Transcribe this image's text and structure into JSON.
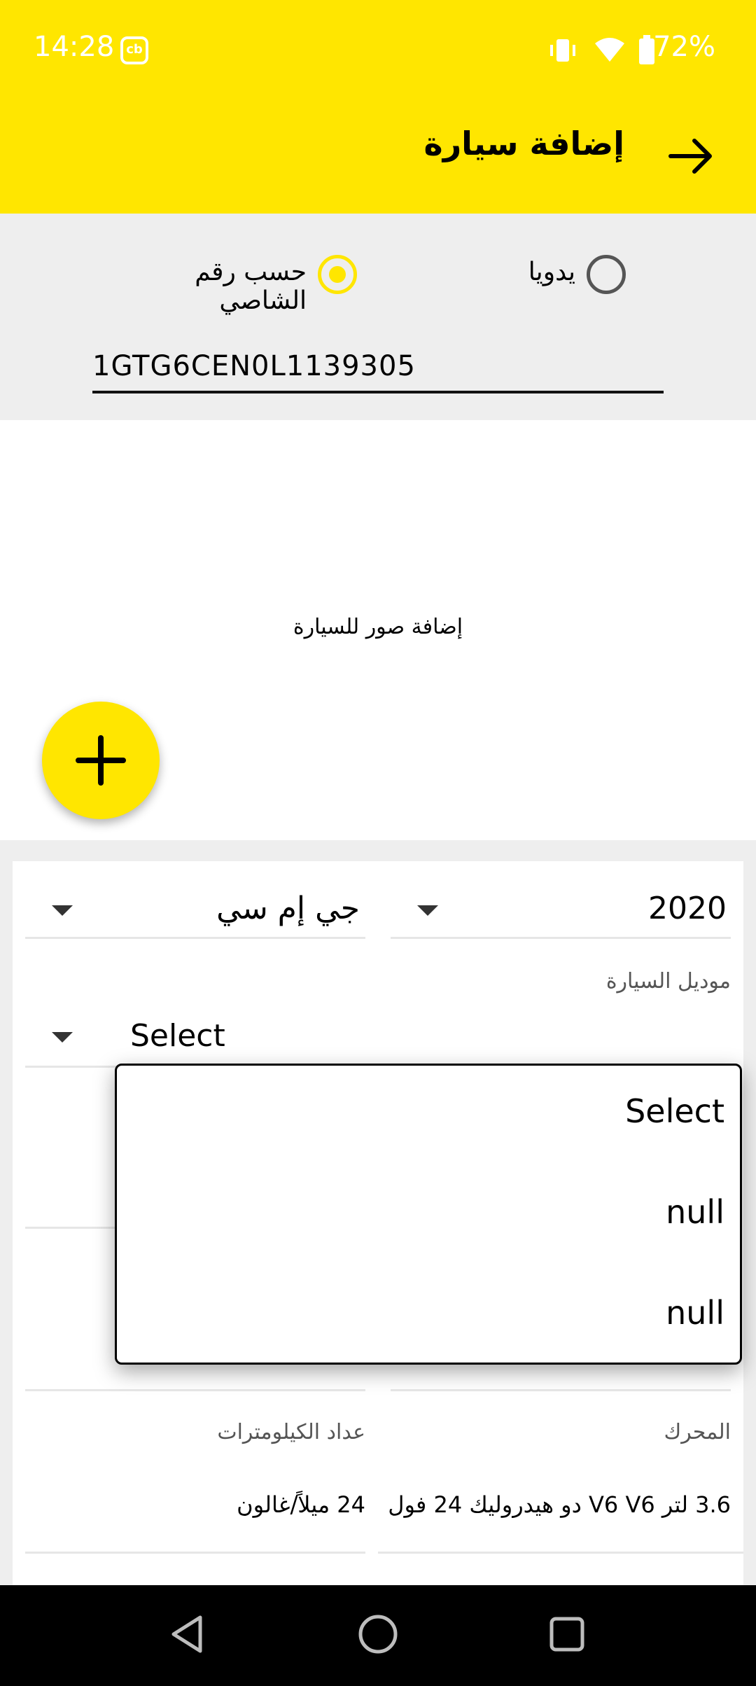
{
  "status_bar": {
    "time": "14:28",
    "battery": "72%",
    "app_badge": "cb"
  },
  "app_bar": {
    "title": "إضافة سيارة"
  },
  "mode": {
    "options": [
      {
        "label": "حسب رقم الشاصي",
        "selected": true
      },
      {
        "label": "يدويا",
        "selected": false
      }
    ],
    "vin_value": "1GTG6CEN0L1139305"
  },
  "photos": {
    "label": "إضافة صور للسيارة"
  },
  "form": {
    "make_value": "جي إم سي",
    "year_value": "2020",
    "model_label": "موديل السيارة",
    "model_value": "Select",
    "mileage_label": "عداد الكيلومترات",
    "mileage_value": "24 ميلاً/غالون",
    "engine_label": "المحرك",
    "engine_value": "3.6 لتر V6 V6 دو هيدروليك 24 فول"
  },
  "dropdown_popup": {
    "options": [
      "Select",
      "null",
      "null"
    ]
  },
  "colors": {
    "accent": "#ffe600",
    "section_bg": "#eeeeee",
    "nav_bar": "#000000"
  }
}
